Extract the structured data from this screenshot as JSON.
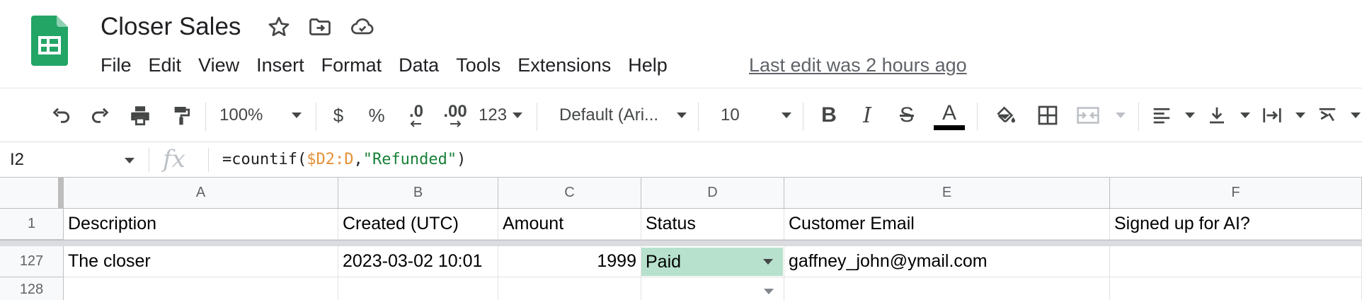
{
  "app": {
    "document_title": "Closer Sales",
    "last_edit": "Last edit was 2 hours ago",
    "menu": [
      "File",
      "Edit",
      "View",
      "Insert",
      "Format",
      "Data",
      "Tools",
      "Extensions",
      "Help"
    ]
  },
  "icons": {
    "logo": "google-sheets-logo",
    "star": "star-icon",
    "move": "move-to-folder-icon",
    "cloud": "cloud-saved-icon"
  },
  "toolbar": {
    "zoom": "100%",
    "currency": "$",
    "percent": "%",
    "decrease_decimals": ".0",
    "increase_decimals": ".00",
    "more_formats": "123",
    "font": "Default (Ari...",
    "font_size": "10",
    "bold": "B",
    "italic": "I",
    "strikethrough": "S",
    "text_color_glyph": "A"
  },
  "formula_bar": {
    "name_box": "I2",
    "fx": "fx",
    "formula_prefix": "=countif(",
    "formula_ref": "$D2:D",
    "formula_comma": ",",
    "formula_string": "\"Refunded\"",
    "formula_suffix": ")"
  },
  "grid": {
    "columns": [
      "A",
      "B",
      "C",
      "D",
      "E",
      "F"
    ],
    "header_row": {
      "number": "1",
      "cells": [
        "Description",
        "Created (UTC)",
        "Amount",
        "Status",
        "Customer Email",
        "Signed up for AI?"
      ]
    },
    "rows": [
      {
        "number": "127",
        "cells": [
          "The closer",
          "2023-03-02 10:01",
          "1999",
          "Paid",
          "gaffney_john@ymail.com",
          ""
        ]
      },
      {
        "number": "128",
        "cells": [
          "",
          "",
          "",
          "",
          "",
          ""
        ]
      }
    ]
  },
  "colors": {
    "sheets_green": "#23a566",
    "paid_chip": "#b7e1cd",
    "formula_ref": "#e69138",
    "formula_string": "#188038"
  }
}
